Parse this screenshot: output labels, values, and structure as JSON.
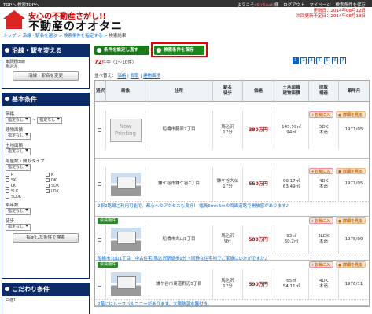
{
  "topbar": {
    "top_link": "TOPへ",
    "search_top_link": "検索TOPへ",
    "greeting": "ようこそ",
    "user": "s6(r6uat)",
    "greeting_suffix": "様",
    "logout": "ログアウト",
    "mypage": "マイページ",
    "search_saved": "検索条件を保存"
  },
  "header": {
    "tagline": "安心の不動産さがし!!",
    "name": "不動産のオオタニ",
    "date1": "更新日：2014年08月12日",
    "date2": "次回更新予定日：2014年08月13日"
  },
  "breadcrumb": [
    "トップ",
    "沿線・駅名を選ぶ",
    "検索条件を指定する",
    "検索結果"
  ],
  "sidebar": {
    "line_title": "沿線・駅を変える",
    "line_text1": "東武野田線",
    "line_text2": "馬込沢",
    "line_button": "沿線・駅名を変更",
    "basic_title": "基本条件",
    "price_label": "価格",
    "sel_none": "指定なし",
    "tilde": "〜",
    "area_label": "建物面積",
    "land_label": "土地面積",
    "layout_label": "部屋数・間取タイプ",
    "layout_opts": [
      "R",
      "K",
      "SK",
      "DK",
      "LK",
      "SDK",
      "SLK",
      "LDK",
      "SLDK"
    ],
    "age_label": "築年数",
    "walk_label": "徒歩",
    "search_button": "指定した条件で検索",
    "kodawari_title": "こだわり条件",
    "kodawari_item": "戸建1"
  },
  "main": {
    "reset_label": "条件を設定し直す",
    "save_label": "検索条件を保存",
    "count_num": "72",
    "count_text": "件中（1〜10件）",
    "pages": [
      "1",
      "2",
      "3",
      "4",
      "5",
      "6",
      "7"
    ],
    "sort_prefix": "並べ替え：",
    "sort_price": "価格",
    "sort_walk": "間取",
    "sort_age": "建物面積",
    "headers": [
      "選択",
      "画像",
      "住所",
      "駅名\n徒歩",
      "価格",
      "土地面積\n建物面積",
      "間取\n構造",
      "築年月"
    ],
    "fav": "お気に入",
    "detail": "詳細を見る"
  },
  "rows": [
    {
      "image": "Now\nPrinting",
      "address": "船橋市藤原7丁目",
      "station": "馬込沢\n17分",
      "price": "380万円",
      "area": "145.59㎡\n94㎡",
      "layout": "5DK\n木造",
      "built": "1971/05",
      "pr": "",
      "badge": ""
    },
    {
      "image": "",
      "address": "鎌ケ谷市鎌ケ谷7丁目",
      "station": "鎌ケ谷大仏\n17分",
      "price": "550万円",
      "area": "99.17㎡\n63.49㎡",
      "layout": "4DK\n木造",
      "built": "1971/05",
      "pr": "2駅2路線ご利用可能で、都心へのアクセスも良好！ 幅員6m×6mの両面道路で開放感があります♪",
      "badge": ""
    },
    {
      "image": "",
      "address": "船橋市丸山1丁目",
      "station": "馬込沢\n9分",
      "price": "580万円",
      "area": "93㎡\n60.2㎡",
      "layout": "3LDK\n木造",
      "built": "1975/09",
      "pr": "船橋市丸山1丁目　中古住宅/馬込沢駅徒歩9分・閑静な住宅地でご家族にいかがですか♪",
      "badge": "会員物件"
    },
    {
      "image": "",
      "address": "鎌ケ谷市東道野辺5丁目",
      "station": "馬込沢\n17分",
      "price": "590万円",
      "area": "65㎡\n54.11㎡",
      "layout": "4DK\n木造",
      "built": "1976/11",
      "pr": "2階にはルーフバルコニーがあります。太陽熱温水器付き。",
      "badge": "会員物件"
    }
  ]
}
